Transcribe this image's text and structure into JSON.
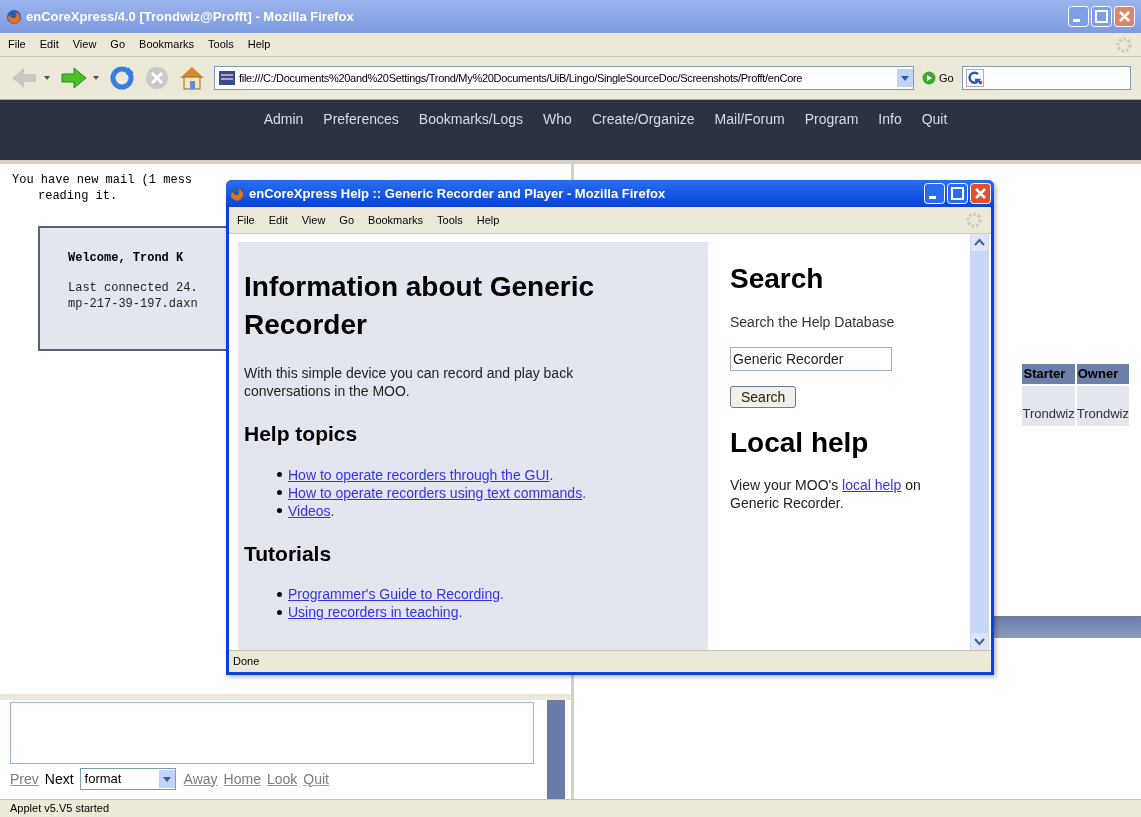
{
  "main_window": {
    "title": "enCoreXpress/4.0 [Trondwiz@Profft] - Mozilla Firefox",
    "menu": [
      "File",
      "Edit",
      "View",
      "Go",
      "Bookmarks",
      "Tools",
      "Help"
    ],
    "address": "file:///C:/Documents%20and%20Settings/Trond/My%20Documents/UiB/Lingo/SingleSourceDoc/Screenshots/Profft/enCore",
    "go_label": "Go",
    "nav": [
      "Admin",
      "Preferences",
      "Bookmarks/Logs",
      "Who",
      "Create/Organize",
      "Mail/Forum",
      "Program",
      "Info",
      "Quit"
    ],
    "output": {
      "mail_notice": "You have new mail (1 mess",
      "mail_notice_cont": "reading it.",
      "welcome": "Welcome, Trond K",
      "last_connected": [
        "Last connected 24.",
        "mp-217-39-197.daxn"
      ]
    },
    "table": {
      "columns": [
        "Starter",
        "Owner"
      ],
      "rows": [
        [
          "Trondwiz",
          "Trondwiz"
        ]
      ]
    },
    "command_links": [
      {
        "label": "Prev",
        "kind": "link"
      },
      {
        "label": "Next",
        "kind": "text"
      },
      {
        "label": "format",
        "kind": "select"
      },
      {
        "label": "Away",
        "kind": "link"
      },
      {
        "label": "Home",
        "kind": "link"
      },
      {
        "label": "Look",
        "kind": "link"
      },
      {
        "label": "Quit",
        "kind": "link"
      }
    ],
    "status_bar": "Applet v5.V5 started"
  },
  "help_window": {
    "title": "enCoreXpress Help :: Generic Recorder and Player - Mozilla Firefox",
    "menu": [
      "File",
      "Edit",
      "View",
      "Go",
      "Bookmarks",
      "Tools",
      "Help"
    ],
    "heading": "Information about Generic Recorder",
    "intro": "With this simple device you can record and play back conversations in the MOO.",
    "sections": [
      {
        "title": "Help topics",
        "links": [
          {
            "label": "How to operate recorders through the GUI",
            "after": "."
          },
          {
            "label": "How to operate recorders using text commands",
            "after": "."
          },
          {
            "label": "Videos",
            "after": "."
          }
        ]
      },
      {
        "title": "Tutorials",
        "links": [
          {
            "label": "Programmer's Guide to Recording",
            "after": "."
          },
          {
            "label": "Using recorders in teaching",
            "after": "."
          }
        ]
      }
    ],
    "search": {
      "title": "Search",
      "label": "Search the Help Database",
      "value": "Generic Recorder",
      "button": "Search"
    },
    "local_help": {
      "title": "Local help",
      "before": "View your MOO's ",
      "link": "local help",
      "after": " on Generic Recorder."
    },
    "status_bar": "Done"
  }
}
